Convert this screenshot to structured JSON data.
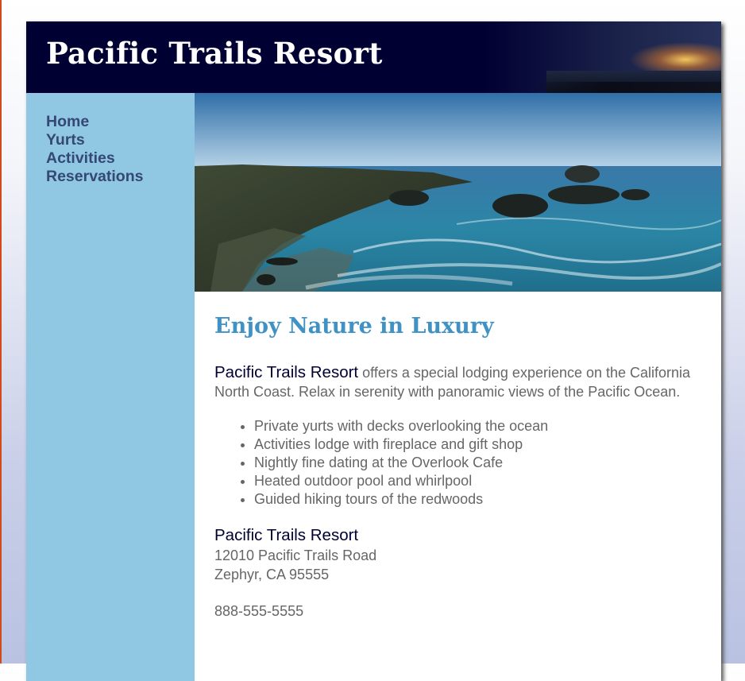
{
  "header": {
    "title": "Pacific Trails Resort"
  },
  "nav": {
    "items": [
      {
        "label": "Home"
      },
      {
        "label": "Yurts"
      },
      {
        "label": "Activities"
      },
      {
        "label": "Reservations"
      }
    ]
  },
  "main": {
    "heading": "Enjoy Nature in Luxury",
    "intro": {
      "resort_name": "Pacific Trails Resort",
      "text": " offers a special lodging experience on the California North Coast. Relax in serenity with panoramic views of the Pacific Ocean."
    },
    "features": [
      "Private yurts with decks overlooking the ocean",
      "Activities lodge with fireplace and gift shop",
      "Nightly fine dating at the Overlook Cafe",
      "Heated outdoor pool and whirlpool",
      "Guided hiking tours of the redwoods"
    ],
    "contact": {
      "name": "Pacific Trails Resort",
      "street": "12010 Pacific Trails Road",
      "city": "Zephyr, CA 95555",
      "phone": "888-555-5555"
    }
  },
  "colors": {
    "header_bg": "#000033",
    "nav_bg": "#90c7e3",
    "nav_link": "#344873",
    "heading": "#3f92c3",
    "body_text": "#666666"
  },
  "images": {
    "header": "sunset-over-ocean",
    "hero": "rocky-coastline-ocean"
  }
}
